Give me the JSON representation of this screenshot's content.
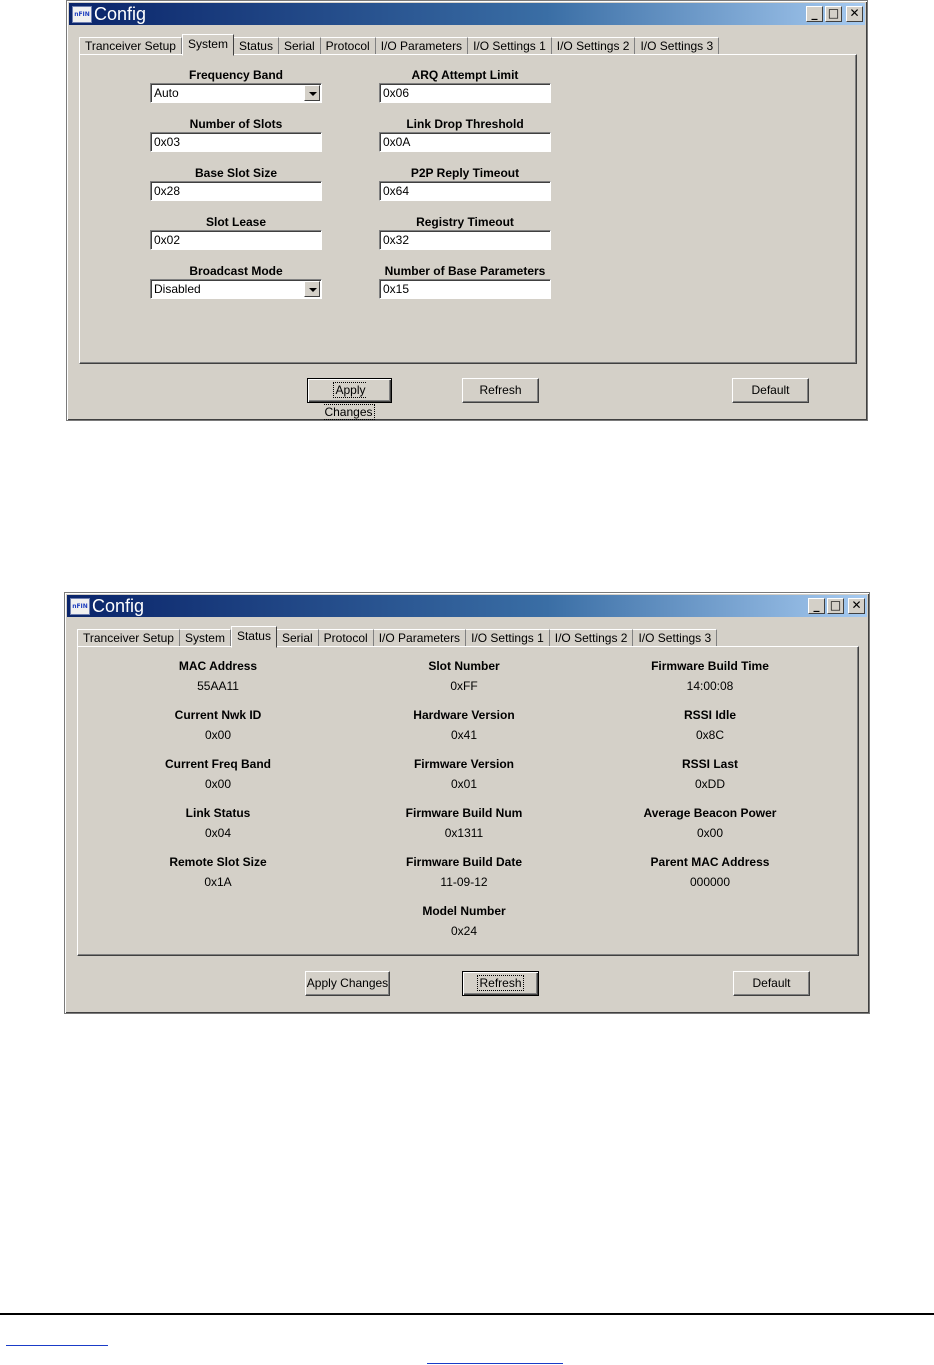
{
  "windows": [
    {
      "title": "Config",
      "icon_label": "nFIN",
      "controls": {
        "minimize": "_",
        "maximize": "□",
        "close": "✕"
      },
      "tabs": [
        "Tranceiver Setup",
        "System",
        "Status",
        "Serial",
        "Protocol",
        "I/O Parameters",
        "I/O Settings 1",
        "I/O Settings 2",
        "I/O Settings 3"
      ],
      "active_tab": "System",
      "fields": [
        {
          "label": "Frequency Band",
          "value": "Auto",
          "type": "dropdown"
        },
        {
          "label": "Number of Slots",
          "value": "0x03",
          "type": "text"
        },
        {
          "label": "Base Slot Size",
          "value": "0x28",
          "type": "text"
        },
        {
          "label": "Slot Lease",
          "value": "0x02",
          "type": "text"
        },
        {
          "label": "Broadcast Mode",
          "value": "Disabled",
          "type": "dropdown"
        },
        {
          "label": "ARQ Attempt Limit",
          "value": "0x06",
          "type": "text"
        },
        {
          "label": "Link Drop Threshold",
          "value": "0x0A",
          "type": "text"
        },
        {
          "label": "P2P Reply Timeout",
          "value": "0x64",
          "type": "text"
        },
        {
          "label": "Registry Timeout",
          "value": "0x32",
          "type": "text"
        },
        {
          "label": "Number of Base Parameters",
          "value": "0x15",
          "type": "text"
        }
      ],
      "buttons": {
        "apply": "Apply Changes",
        "refresh": "Refresh",
        "default": "Default"
      }
    },
    {
      "title": "Config",
      "icon_label": "nFIN",
      "controls": {
        "minimize": "_",
        "maximize": "□",
        "close": "✕"
      },
      "tabs": [
        "Tranceiver Setup",
        "System",
        "Status",
        "Serial",
        "Protocol",
        "I/O Parameters",
        "I/O Settings 1",
        "I/O Settings 2",
        "I/O Settings 3"
      ],
      "active_tab": "Status",
      "status": [
        {
          "label": "MAC Address",
          "value": "55AA11"
        },
        {
          "label": "Current Nwk ID",
          "value": "0x00"
        },
        {
          "label": "Current Freq Band",
          "value": "0x00"
        },
        {
          "label": "Link Status",
          "value": "0x04"
        },
        {
          "label": "Remote Slot Size",
          "value": "0x1A"
        },
        {
          "label": "Slot Number",
          "value": "0xFF"
        },
        {
          "label": "Hardware Version",
          "value": "0x41"
        },
        {
          "label": "Firmware Version",
          "value": "0x01"
        },
        {
          "label": "Firmware Build Num",
          "value": "0x1311"
        },
        {
          "label": "Firmware Build Date",
          "value": "11-09-12"
        },
        {
          "label": "Model Number",
          "value": "0x24"
        },
        {
          "label": "Firmware Build Time",
          "value": "14:00:08"
        },
        {
          "label": "RSSI Idle",
          "value": "0x8C"
        },
        {
          "label": "RSSI Last",
          "value": "0xDD"
        },
        {
          "label": "Average Beacon Power",
          "value": "0x00"
        },
        {
          "label": "Parent MAC Address",
          "value": "000000"
        }
      ],
      "buttons": {
        "apply": "Apply Changes",
        "refresh": "Refresh",
        "default": "Default"
      }
    }
  ]
}
